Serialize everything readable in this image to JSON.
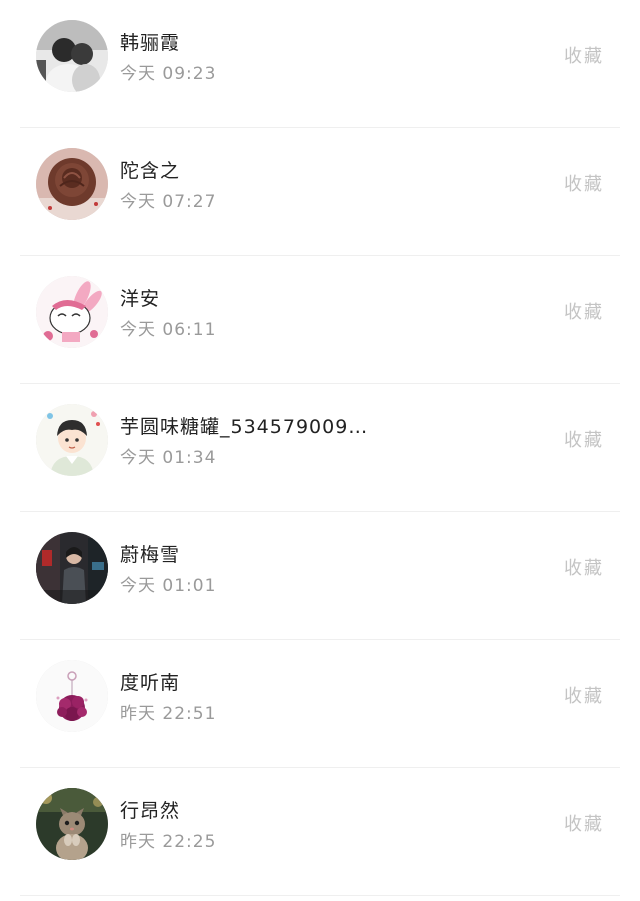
{
  "contacts": [
    {
      "name": "韩骊霞",
      "time": "今天 09:23",
      "action": "收藏",
      "avatar": "couple-photo-avatar"
    },
    {
      "name": "陀含之",
      "time": "今天 07:27",
      "action": "收藏",
      "avatar": "rose-avatar"
    },
    {
      "name": "洋安",
      "time": "今天 06:11",
      "action": "收藏",
      "avatar": "pink-bunny-avatar"
    },
    {
      "name": "芋圆味糖罐_534579009…",
      "time": "今天 01:34",
      "action": "收藏",
      "avatar": "cartoon-boy-avatar"
    },
    {
      "name": "蔚梅雪",
      "time": "今天 01:01",
      "action": "收藏",
      "avatar": "street-photo-avatar"
    },
    {
      "name": "度听南",
      "time": "昨天 22:51",
      "action": "收藏",
      "avatar": "purple-flower-avatar"
    },
    {
      "name": "行昂然",
      "time": "昨天 22:25",
      "action": "收藏",
      "avatar": "kitten-avatar"
    }
  ],
  "colors": {
    "background": "#ffffff",
    "name_text": "#222222",
    "time_text": "#9a9a9a",
    "action_text": "#c4c4c4",
    "divider": "#efefef"
  }
}
